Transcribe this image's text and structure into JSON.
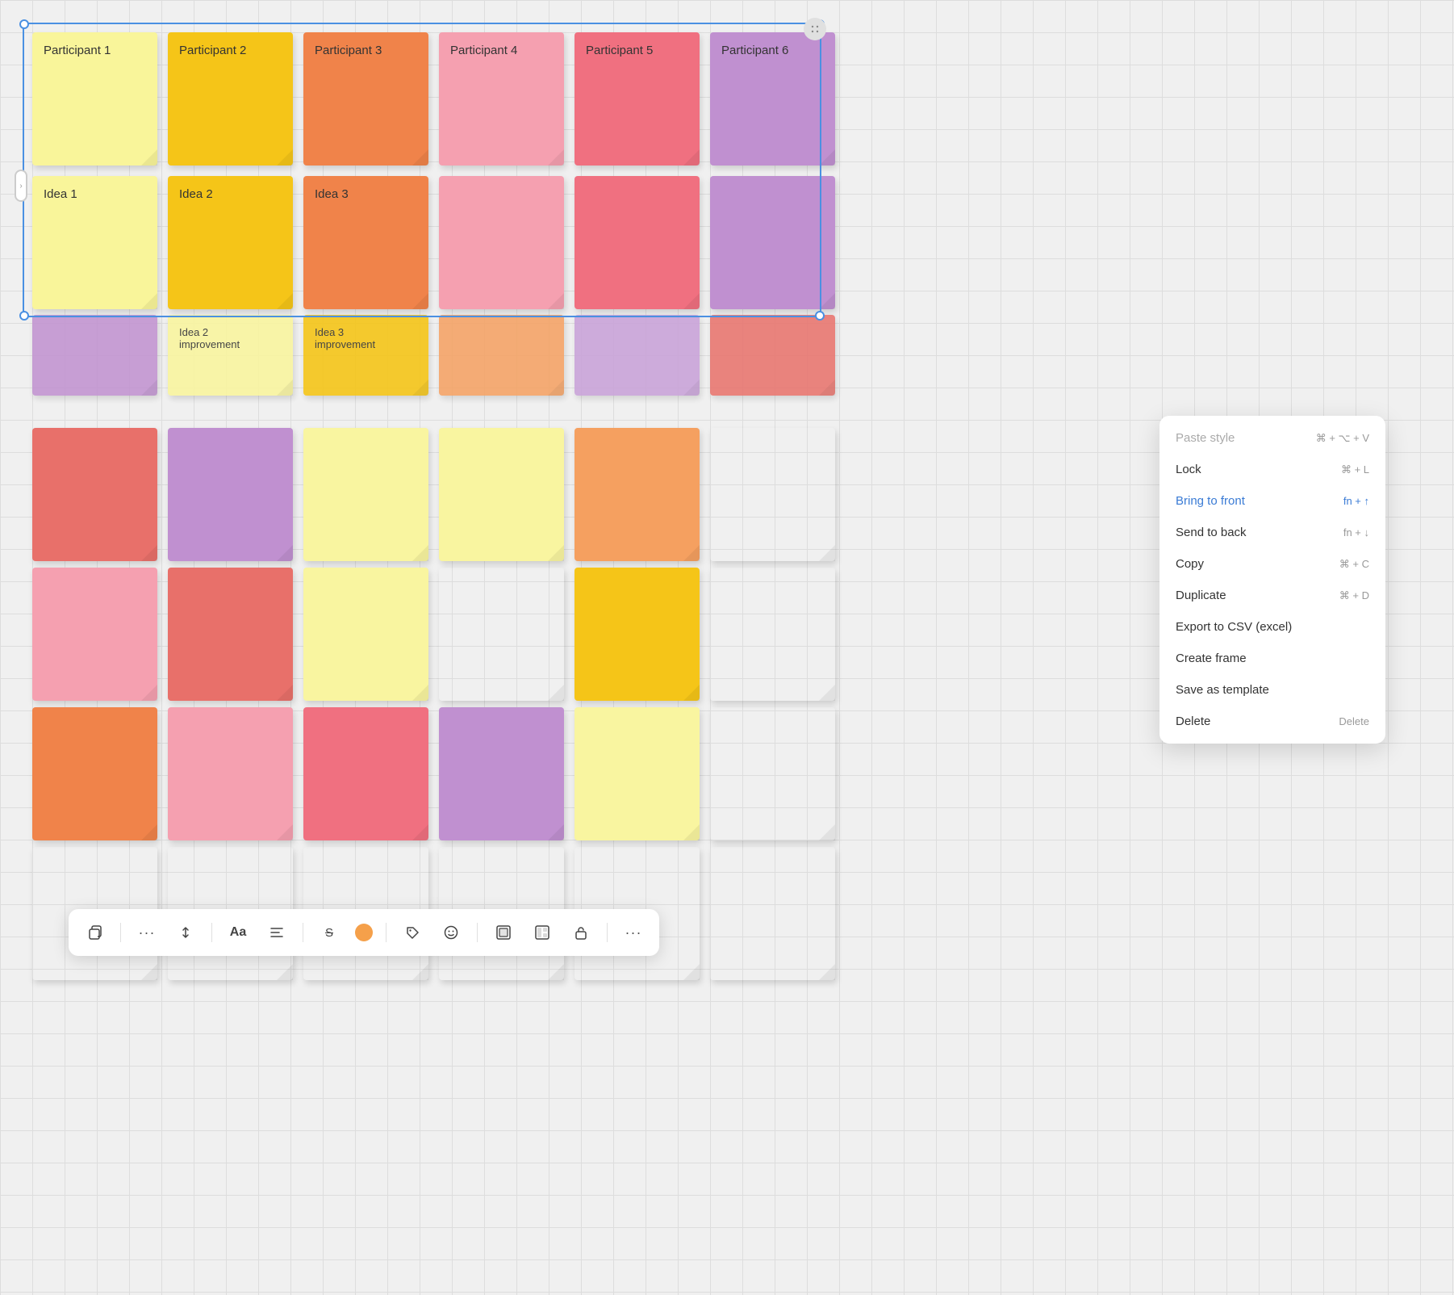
{
  "canvas": {
    "background": "#f0f0f0"
  },
  "stickies_row1": [
    {
      "label": "Participant 1",
      "color": "yellow-light"
    },
    {
      "label": "Participant 2",
      "color": "yellow"
    },
    {
      "label": "Participant 3",
      "color": "orange"
    },
    {
      "label": "Participant 4",
      "color": "pink-light"
    },
    {
      "label": "Participant 5",
      "color": "pink"
    },
    {
      "label": "Participant 6",
      "color": "purple"
    }
  ],
  "stickies_row2": [
    {
      "label": "Idea 1",
      "color": "yellow-light"
    },
    {
      "label": "Idea 2",
      "color": "yellow"
    },
    {
      "label": "Idea 3",
      "color": "orange"
    },
    {
      "label": "",
      "color": "pink-light"
    },
    {
      "label": "",
      "color": "pink"
    },
    {
      "label": "",
      "color": "purple"
    }
  ],
  "stickies_improvement": [
    {
      "label": "",
      "color": "purple"
    },
    {
      "label": "Idea 2\nimprovement",
      "color": "yellow-pale"
    },
    {
      "label": "Idea 3\nimprovement",
      "color": "yellow"
    },
    {
      "label": "",
      "color": "orange-light"
    },
    {
      "label": "",
      "color": "purple-light"
    },
    {
      "label": "",
      "color": "coral"
    }
  ],
  "stickies_lower": [
    {
      "label": "",
      "color": "coral"
    },
    {
      "label": "",
      "color": "purple"
    },
    {
      "label": "",
      "color": "yellow-pale"
    },
    {
      "label": "",
      "color": "yellow-pale"
    },
    {
      "label": "",
      "color": "orange-light"
    },
    {
      "label": "",
      "color": ""
    },
    {
      "label": "",
      "color": "pink-light"
    },
    {
      "label": "",
      "color": "coral"
    },
    {
      "label": "",
      "color": "yellow-pale"
    },
    {
      "label": "",
      "color": ""
    },
    {
      "label": "",
      "color": "yellow"
    },
    {
      "label": "",
      "color": ""
    },
    {
      "label": "",
      "color": "orange"
    },
    {
      "label": "",
      "color": "pink-light"
    },
    {
      "label": "",
      "color": "pink"
    },
    {
      "label": "",
      "color": "purple"
    },
    {
      "label": "",
      "color": "yellow-pale"
    },
    {
      "label": "",
      "color": ""
    },
    {
      "label": "",
      "color": ""
    },
    {
      "label": "",
      "color": ""
    },
    {
      "label": "",
      "color": ""
    },
    {
      "label": "",
      "color": ""
    },
    {
      "label": "",
      "color": ""
    },
    {
      "label": "",
      "color": ""
    }
  ],
  "toolbar": {
    "copy_icon": "⬜",
    "more_icon": "···",
    "position_icon": "⇅",
    "font_label": "Aa",
    "align_icon": "≡",
    "strike_label": "S",
    "color_hex": "#f5a04a",
    "tag_icon": "◇",
    "emoji_icon": "☺",
    "frame_icon": "▣",
    "frame2_icon": "⊡",
    "lock_icon": "🔓",
    "overflow_icon": "···"
  },
  "context_menu": {
    "items": [
      {
        "label": "Paste style",
        "shortcut": "⌘ + ⌥ + V",
        "active": false,
        "disabled": true
      },
      {
        "label": "Lock",
        "shortcut": "⌘ + L",
        "active": false
      },
      {
        "label": "Bring to front",
        "shortcut": "fn + ↑",
        "active": true
      },
      {
        "label": "Send to back",
        "shortcut": "fn + ↓",
        "active": false
      },
      {
        "label": "Copy",
        "shortcut": "⌘ + C",
        "active": false
      },
      {
        "label": "Duplicate",
        "shortcut": "⌘ + D",
        "active": false
      },
      {
        "label": "Export to CSV (excel)",
        "shortcut": "",
        "active": false
      },
      {
        "label": "Create frame",
        "shortcut": "",
        "active": false
      },
      {
        "label": "Save as template",
        "shortcut": "",
        "active": false
      },
      {
        "label": "Delete",
        "shortcut": "Delete",
        "active": false
      }
    ]
  }
}
